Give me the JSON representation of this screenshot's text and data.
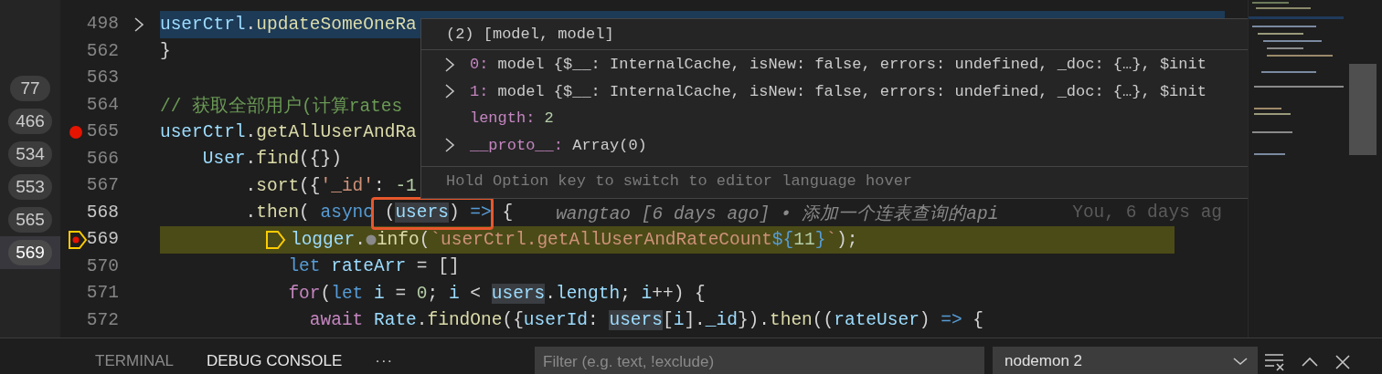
{
  "call_stack": [
    {
      "label": "77",
      "selected": false
    },
    {
      "label": "466",
      "selected": false
    },
    {
      "label": "534",
      "selected": false
    },
    {
      "label": "553",
      "selected": false
    },
    {
      "label": "565",
      "selected": false
    },
    {
      "label": "569",
      "selected": true
    }
  ],
  "editor": {
    "lines": [
      {
        "number": "498",
        "breakpoint": false,
        "current": false,
        "selected": true,
        "folded": true,
        "segments": [
          {
            "kind": "code",
            "tokens": [
              {
                "kind": "variable",
                "text": "userCtrl"
              },
              {
                "kind": "plain",
                "text": "."
              },
              {
                "kind": "function",
                "text": "updateSomeOneRa"
              }
            ]
          }
        ]
      },
      {
        "number": "562",
        "breakpoint": false,
        "current": false,
        "selected": false,
        "folded": false,
        "segments": [
          {
            "kind": "code",
            "tokens": [
              {
                "kind": "plain",
                "text": "}"
              }
            ]
          }
        ]
      },
      {
        "number": "563",
        "breakpoint": false,
        "current": false,
        "selected": false,
        "folded": false
      },
      {
        "number": "564",
        "breakpoint": false,
        "current": false,
        "selected": false,
        "folded": false,
        "segments": [
          {
            "kind": "code",
            "tokens": [
              {
                "kind": "comment",
                "text": "// 获取全部用户(计算rates"
              }
            ]
          }
        ]
      },
      {
        "number": "565",
        "breakpoint": true,
        "current": false,
        "selected": false,
        "folded": false,
        "segments": [
          {
            "kind": "code",
            "tokens": [
              {
                "kind": "variable",
                "text": "userCtrl"
              },
              {
                "kind": "plain",
                "text": "."
              },
              {
                "kind": "function",
                "text": "getAllUserAndRa"
              }
            ]
          }
        ]
      },
      {
        "number": "566",
        "breakpoint": false,
        "current": false,
        "selected": false,
        "folded": false,
        "segments": [
          {
            "kind": "code",
            "tokens": [
              {
                "kind": "variable",
                "text": "    User"
              },
              {
                "kind": "plain",
                "text": "."
              },
              {
                "kind": "function",
                "text": "find"
              },
              {
                "kind": "plain",
                "text": "({})"
              }
            ]
          }
        ]
      },
      {
        "number": "567",
        "breakpoint": false,
        "current": false,
        "selected": false,
        "folded": false,
        "segments": [
          {
            "kind": "code",
            "tokens": [
              {
                "kind": "plain",
                "text": "        ."
              },
              {
                "kind": "function",
                "text": "sort"
              },
              {
                "kind": "plain",
                "text": "({"
              },
              {
                "kind": "string",
                "text": "'_id'"
              },
              {
                "kind": "plain",
                "text": ": "
              },
              {
                "kind": "number",
                "text": "-1"
              }
            ]
          }
        ]
      },
      {
        "number": "568",
        "breakpoint": false,
        "current": false,
        "selected": false,
        "folded": false,
        "segments": [
          {
            "kind": "code",
            "tokens": [
              {
                "kind": "plain",
                "text": "        ."
              },
              {
                "kind": "function",
                "text": "then"
              },
              {
                "kind": "plain",
                "text": "( "
              },
              {
                "kind": "keyword",
                "text": "async"
              },
              {
                "kind": "plain",
                "text": " ("
              },
              {
                "kind": "occurrence",
                "text": "users"
              },
              {
                "kind": "plain",
                "text": ") "
              },
              {
                "kind": "keyword",
                "text": "=>"
              },
              {
                "kind": "plain",
                "text": " {"
              }
            ]
          },
          {
            "kind": "blame",
            "text": "wangtao [6 days ago] • 添加一个连表查询的api"
          },
          {
            "kind": "author",
            "text": "You, 6 days ag"
          }
        ]
      },
      {
        "number": "569",
        "breakpoint": true,
        "current": true,
        "selected": false,
        "folded": false,
        "segments": [
          {
            "kind": "stack-frame"
          },
          {
            "kind": "code",
            "tokens": [
              {
                "kind": "variable",
                "text": "logger"
              },
              {
                "kind": "plain",
                "text": "."
              }
            ]
          },
          {
            "kind": "inline-breakpoint"
          },
          {
            "kind": "code",
            "tokens": [
              {
                "kind": "function",
                "text": "info"
              },
              {
                "kind": "plain",
                "text": "("
              },
              {
                "kind": "string",
                "text": "`userCtrl.getAllUserAndRateCount"
              },
              {
                "kind": "keyword",
                "text": "${"
              },
              {
                "kind": "number",
                "text": "11"
              },
              {
                "kind": "keyword",
                "text": "}"
              },
              {
                "kind": "string",
                "text": "`"
              },
              {
                "kind": "plain",
                "text": ");"
              }
            ]
          }
        ]
      },
      {
        "number": "570",
        "breakpoint": false,
        "current": false,
        "selected": false,
        "folded": false,
        "segments": [
          {
            "kind": "code",
            "tokens": [
              {
                "kind": "keyword",
                "text": "            let"
              },
              {
                "kind": "variable",
                "text": " rateArr"
              },
              {
                "kind": "plain",
                "text": " = []"
              }
            ]
          }
        ]
      },
      {
        "number": "571",
        "breakpoint": false,
        "current": false,
        "selected": false,
        "folded": false,
        "segments": [
          {
            "kind": "code",
            "tokens": [
              {
                "kind": "control",
                "text": "            for"
              },
              {
                "kind": "plain",
                "text": "("
              },
              {
                "kind": "keyword",
                "text": "let"
              },
              {
                "kind": "variable",
                "text": " i"
              },
              {
                "kind": "plain",
                "text": " = "
              },
              {
                "kind": "number",
                "text": "0"
              },
              {
                "kind": "plain",
                "text": "; "
              },
              {
                "kind": "variable",
                "text": "i"
              },
              {
                "kind": "plain",
                "text": " < "
              },
              {
                "kind": "occurrence",
                "text": "users"
              },
              {
                "kind": "plain",
                "text": "."
              },
              {
                "kind": "variable",
                "text": "length"
              },
              {
                "kind": "plain",
                "text": "; "
              },
              {
                "kind": "variable",
                "text": "i"
              },
              {
                "kind": "plain",
                "text": "++) {"
              }
            ]
          }
        ]
      },
      {
        "number": "572",
        "breakpoint": false,
        "current": false,
        "selected": false,
        "folded": false,
        "segments": [
          {
            "kind": "code",
            "tokens": [
              {
                "kind": "control",
                "text": "              await"
              },
              {
                "kind": "variable",
                "text": " Rate"
              },
              {
                "kind": "plain",
                "text": "."
              },
              {
                "kind": "function",
                "text": "findOne"
              },
              {
                "kind": "plain",
                "text": "({"
              },
              {
                "kind": "variable",
                "text": "userId"
              },
              {
                "kind": "plain",
                "text": ": "
              },
              {
                "kind": "occurrence",
                "text": "users"
              },
              {
                "kind": "plain",
                "text": "["
              },
              {
                "kind": "variable",
                "text": "i"
              },
              {
                "kind": "plain",
                "text": "]."
              },
              {
                "kind": "variable",
                "text": "_id"
              },
              {
                "kind": "plain",
                "text": "})."
              },
              {
                "kind": "function",
                "text": "then"
              },
              {
                "kind": "plain",
                "text": "(("
              },
              {
                "kind": "variable",
                "text": "rateUser"
              },
              {
                "kind": "plain",
                "text": ") "
              },
              {
                "kind": "keyword",
                "text": "=>"
              },
              {
                "kind": "plain",
                "text": " {"
              }
            ]
          }
        ]
      }
    ]
  },
  "hover": {
    "title": "(2) [model, model]",
    "items": [
      {
        "key": "0:",
        "value": "model {$__: InternalCache, isNew: false, errors: undefined, _doc: {…}, $init",
        "kind": "object",
        "expandable": true
      },
      {
        "key": "1:",
        "value": "model {$__: InternalCache, isNew: false, errors: undefined, _doc: {…}, $init",
        "kind": "object",
        "expandable": true
      },
      {
        "key": "length:",
        "value": "2",
        "kind": "number",
        "expandable": false
      },
      {
        "key": "__proto__:",
        "value": "Array(0)",
        "kind": "object",
        "expandable": true
      }
    ],
    "hint": "Hold Option key to switch to editor language hover"
  },
  "panel": {
    "tabs": [
      {
        "label": "TERMINAL",
        "selected": false
      },
      {
        "label": "DEBUG CONSOLE",
        "selected": true
      }
    ],
    "more": "···",
    "filter": {
      "placeholder": "Filter (e.g. text, !exclude)"
    },
    "session": "nodemon 2"
  }
}
